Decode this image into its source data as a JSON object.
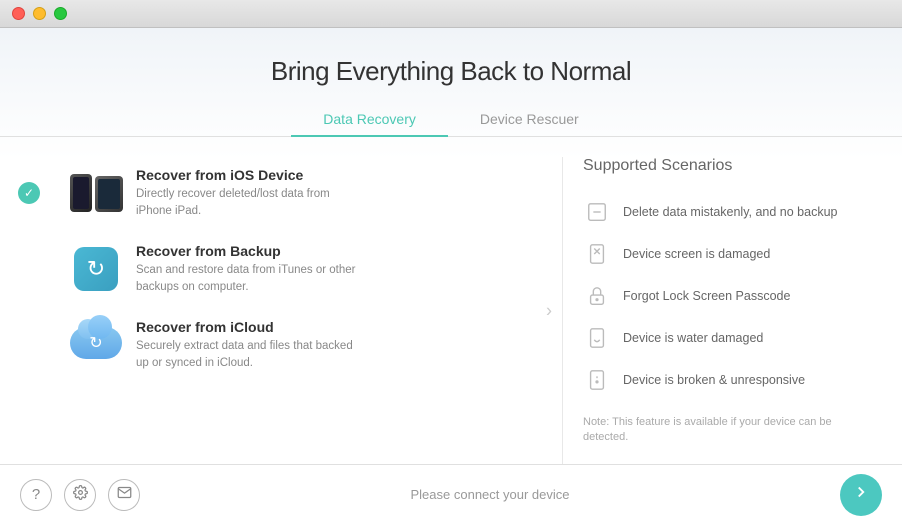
{
  "titleBar": {
    "trafficLights": [
      "red",
      "yellow",
      "green"
    ]
  },
  "header": {
    "title": "Bring Everything Back to Normal"
  },
  "tabs": [
    {
      "id": "data-recovery",
      "label": "Data Recovery",
      "active": true
    },
    {
      "id": "device-rescuer",
      "label": "Device Rescuer",
      "active": false
    }
  ],
  "recoveryOptions": [
    {
      "id": "ios-device",
      "title": "Recover from iOS Device",
      "description": "Directly recover deleted/lost data from iPhone iPad.",
      "selected": true,
      "iconType": "ios"
    },
    {
      "id": "backup",
      "title": "Recover from Backup",
      "description": "Scan and restore data from iTunes or other backups on computer.",
      "selected": false,
      "iconType": "backup"
    },
    {
      "id": "icloud",
      "title": "Recover from iCloud",
      "description": "Securely extract data and files that backed up or synced in iCloud.",
      "selected": false,
      "iconType": "icloud"
    }
  ],
  "scenarios": {
    "title": "Supported Scenarios",
    "items": [
      {
        "id": "delete",
        "text": "Delete data mistakenly, and no backup"
      },
      {
        "id": "screen-damaged",
        "text": "Device screen is damaged"
      },
      {
        "id": "lock-screen",
        "text": "Forgot Lock Screen Passcode"
      },
      {
        "id": "water-damaged",
        "text": "Device is water damaged"
      },
      {
        "id": "broken",
        "text": "Device is broken & unresponsive"
      }
    ],
    "note": "Note: This feature is available if your device can be detected."
  },
  "footer": {
    "status": "Please connect your device",
    "buttons": {
      "help": "?",
      "settings": "⚙",
      "email": "✉"
    },
    "next": "→"
  }
}
